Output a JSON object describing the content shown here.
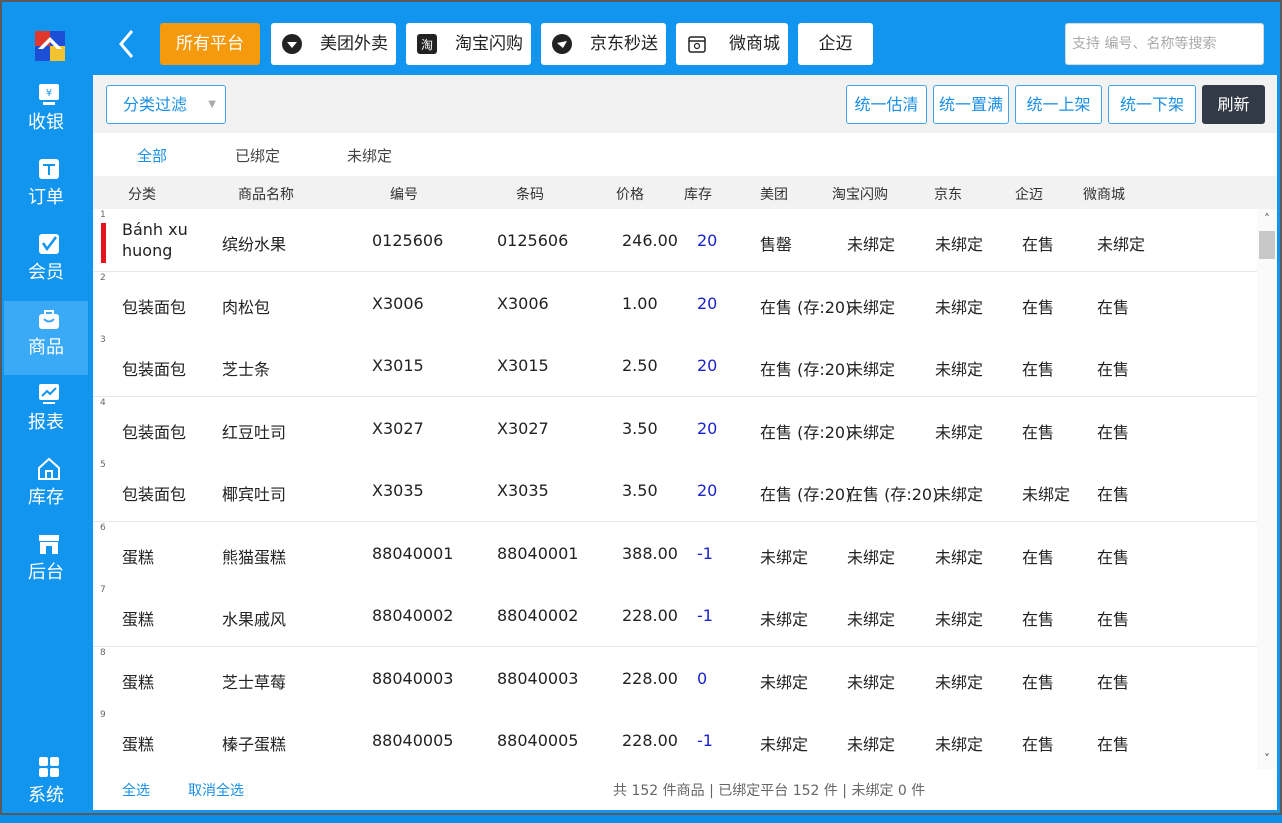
{
  "sidebar": {
    "items": [
      {
        "label": "收银",
        "icon": "cashier-icon"
      },
      {
        "label": "订单",
        "icon": "order-icon"
      },
      {
        "label": "会员",
        "icon": "member-icon"
      },
      {
        "label": "商品",
        "icon": "goods-icon",
        "active": true
      },
      {
        "label": "报表",
        "icon": "report-icon"
      },
      {
        "label": "库存",
        "icon": "inventory-icon"
      },
      {
        "label": "后台",
        "icon": "backend-icon"
      },
      {
        "label": "系统",
        "icon": "system-icon"
      }
    ]
  },
  "topbar": {
    "platforms": [
      {
        "label": "所有平台",
        "active": true
      },
      {
        "label": "美团外卖",
        "icon": "meituan-icon"
      },
      {
        "label": "淘宝闪购",
        "icon": "taobao-icon"
      },
      {
        "label": "京东秒送",
        "icon": "jd-icon"
      },
      {
        "label": "微商城",
        "icon": "wechat-mall-icon"
      },
      {
        "label": "企迈"
      }
    ],
    "search_placeholder": "支持 编号、名称等搜索"
  },
  "toolbar": {
    "filter_label": "分类过滤",
    "buttons": [
      "统一估清",
      "统一置满",
      "统一上架",
      "统一下架"
    ],
    "refresh_label": "刷新"
  },
  "subtabs": [
    {
      "label": "全部",
      "active": true
    },
    {
      "label": "已绑定"
    },
    {
      "label": "未绑定"
    }
  ],
  "table": {
    "columns": [
      "分类",
      "商品名称",
      "编号",
      "条码",
      "价格",
      "库存",
      "美团",
      "淘宝闪购",
      "京东",
      "企迈",
      "微商城"
    ],
    "rows": [
      {
        "n": "1",
        "cat": "Bánh xu huong",
        "name": "缤纷水果",
        "code": "0125606",
        "barcode": "0125606",
        "price": "246.00",
        "stock": "20",
        "meituan": "售罄",
        "taobao": "未绑定",
        "jd": "未绑定",
        "qimai": "在售",
        "wsc": "未绑定"
      },
      {
        "n": "2",
        "cat": "包装面包",
        "name": "肉松包",
        "code": "X3006",
        "barcode": "X3006",
        "price": "1.00",
        "stock": "20",
        "meituan": "在售 (存:20)",
        "taobao": "未绑定",
        "jd": "未绑定",
        "qimai": "在售",
        "wsc": "在售"
      },
      {
        "n": "3",
        "cat": "包装面包",
        "name": "芝士条",
        "code": "X3015",
        "barcode": "X3015",
        "price": "2.50",
        "stock": "20",
        "meituan": "在售 (存:20)",
        "taobao": "未绑定",
        "jd": "未绑定",
        "qimai": "在售",
        "wsc": "在售"
      },
      {
        "n": "4",
        "cat": "包装面包",
        "name": "红豆吐司",
        "code": "X3027",
        "barcode": "X3027",
        "price": "3.50",
        "stock": "20",
        "meituan": "在售 (存:20)",
        "taobao": "未绑定",
        "jd": "未绑定",
        "qimai": "在售",
        "wsc": "在售"
      },
      {
        "n": "5",
        "cat": "包装面包",
        "name": "椰宾吐司",
        "code": "X3035",
        "barcode": "X3035",
        "price": "3.50",
        "stock": "20",
        "meituan": "在售 (存:20)",
        "taobao": "在售 (存:20)",
        "jd": "未绑定",
        "qimai": "未绑定",
        "wsc": "在售"
      },
      {
        "n": "6",
        "cat": "蛋糕",
        "name": "熊猫蛋糕",
        "code": "88040001",
        "barcode": "88040001",
        "price": "388.00",
        "stock": "-1",
        "meituan": "未绑定",
        "taobao": "未绑定",
        "jd": "未绑定",
        "qimai": "在售",
        "wsc": "在售"
      },
      {
        "n": "7",
        "cat": "蛋糕",
        "name": "水果戚风",
        "code": "88040002",
        "barcode": "88040002",
        "price": "228.00",
        "stock": "-1",
        "meituan": "未绑定",
        "taobao": "未绑定",
        "jd": "未绑定",
        "qimai": "在售",
        "wsc": "在售"
      },
      {
        "n": "8",
        "cat": "蛋糕",
        "name": "芝士草莓",
        "code": "88040003",
        "barcode": "88040003",
        "price": "228.00",
        "stock": "0",
        "meituan": "未绑定",
        "taobao": "未绑定",
        "jd": "未绑定",
        "qimai": "在售",
        "wsc": "在售"
      },
      {
        "n": "9",
        "cat": "蛋糕",
        "name": "榛子蛋糕",
        "code": "88040005",
        "barcode": "88040005",
        "price": "228.00",
        "stock": "-1",
        "meituan": "未绑定",
        "taobao": "未绑定",
        "jd": "未绑定",
        "qimai": "在售",
        "wsc": "在售"
      }
    ]
  },
  "footer": {
    "select_all": "全选",
    "deselect_all": "取消全选",
    "summary": "共 152 件商品 | 已绑定平台 152 件 | 未绑定 0 件"
  }
}
